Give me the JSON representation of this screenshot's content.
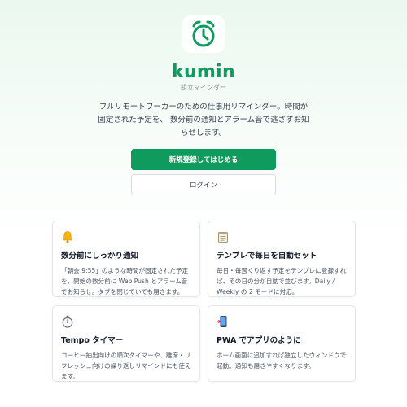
{
  "app": {
    "name": "kumin",
    "subtitle": "組立マインダー",
    "description": "フルリモートワーカーのための仕事用リマインダー。時間が固定された予定を、 数分前の通知とアラーム音で逃さずお知らせします。",
    "logo_icon": "alarm-clock-icon",
    "accent_color": "#0f9a5e"
  },
  "actions": {
    "signup_label": "新規登録してはじめる",
    "login_label": "ログイン"
  },
  "features": [
    {
      "icon": "bell-icon",
      "title": "数分前にしっかり通知",
      "text": "「朝会 9:55」のような時間が固定された予定を、開始の数分前に Web Push とアラーム音でお知らせ。タブを閉じていても届きます。"
    },
    {
      "icon": "notepad-icon",
      "title": "テンプレで毎日を自動セット",
      "text": "毎日・毎週くり返す予定をテンプレに登録すれば、その日の分が自動で並びます。Daily / Weekly の 2 モードに対応。"
    },
    {
      "icon": "stopwatch-icon",
      "title": "Tempo タイマー",
      "text": "コーヒー抽出向けの順次タイマーや、離席・リフレッシュ向けの繰り返しリマインドにも使えます。"
    },
    {
      "icon": "mobile-phone-icon",
      "title": "PWA でアプリのように",
      "text": "ホーム画面に追加すれば独立したウィンドウで起動。通知も届きやすくなります。"
    }
  ]
}
